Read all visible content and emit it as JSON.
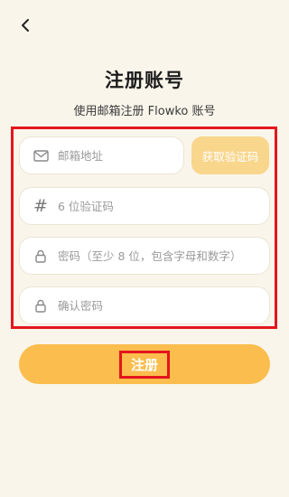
{
  "header": {
    "back_icon": "chevron-left-icon",
    "title": "注册账号",
    "subtitle": "使用邮箱注册 Flowko 账号"
  },
  "form": {
    "email": {
      "placeholder": "邮箱地址",
      "icon": "mail-icon"
    },
    "get_code_label": "获取验证码",
    "code": {
      "placeholder": "6 位验证码",
      "icon": "hash-icon"
    },
    "password": {
      "placeholder": "密码（至少 8 位，包含字母和数字）",
      "icon": "lock-icon"
    },
    "confirm": {
      "placeholder": "确认密码",
      "icon": "lock-icon"
    },
    "submit_label": "注册"
  },
  "colors": {
    "background": "#f9f5ea",
    "accent": "#fbbd4d",
    "accent_light": "#f8d68c",
    "highlight": "#e3161e"
  }
}
